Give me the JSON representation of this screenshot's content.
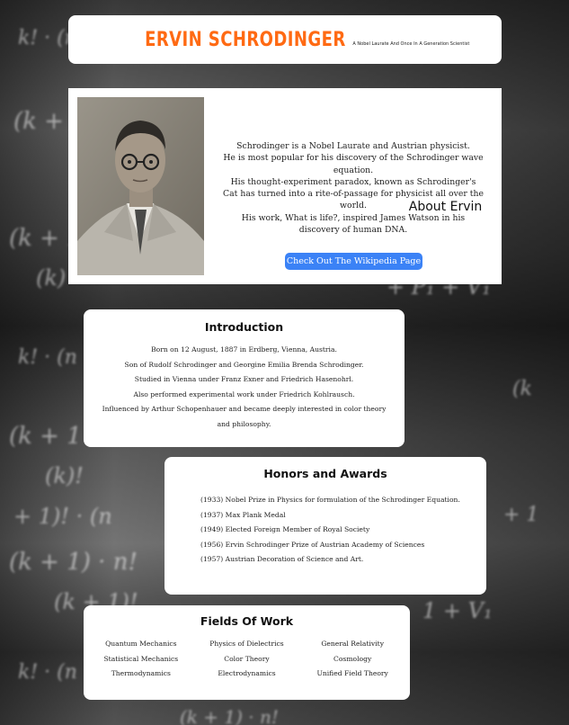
{
  "header": {
    "title": "ERVIN SCHRODINGER",
    "tagline": "A Nobel Laurate And Once In A Generation Scientist"
  },
  "about": {
    "title": "About Ervin",
    "paragraph_lines": [
      "Schrodinger is a Nobel Laurate and Austrian physicist.",
      "He is most popular for his discovery of the Schrodinger wave equation.",
      "His thought-experiment paradox, known as Schrodinger's Cat has turned into a rite-of-passage for physicist all over the world.",
      "His work, What is life?, inspired James Watson in his discovery of human DNA."
    ],
    "button_label": "Check Out The Wikipedia  Page"
  },
  "introduction": {
    "title": "Introduction",
    "items": [
      "Born on 12 August, 1887 in Erdberg, Vienna, Austria.",
      "Son of Rudolf Schrodinger and Georgine Emilia Brenda Schrodinger.",
      "Studied in Vienna under Franz Exner and Friedrich Hasenohrl.",
      "Also performed experimental work under Friedrich Kohlrausch.",
      "Influenced by Arthur Schopenhauer and became deeply interested in color theory and philosophy."
    ]
  },
  "honors": {
    "title": "Honors and Awards",
    "items": [
      "(1933) Nobel Prize in Physics for formulation of the Schrodinger Equation.",
      "(1937) Max Plank Medal",
      "(1949) Elected Foreign Member of Royal Society",
      "(1956) Ervin Schrodinger Prize of Austrian Academy of Sciences",
      "(1957) Austrian Decoration of Science and Art."
    ]
  },
  "fields": {
    "title": "Fields Of Work",
    "items": [
      "Quantum Mechanics",
      "Physics of Dielectrics",
      "General Relativity",
      "Statistical Mechanics",
      "Color Theory",
      "Cosmology",
      "Thermodynamics",
      "Electrodynamics",
      "Unified Field Theory"
    ]
  },
  "colors": {
    "title_orange": "#ff6a13",
    "button_blue": "#3b82f6"
  }
}
